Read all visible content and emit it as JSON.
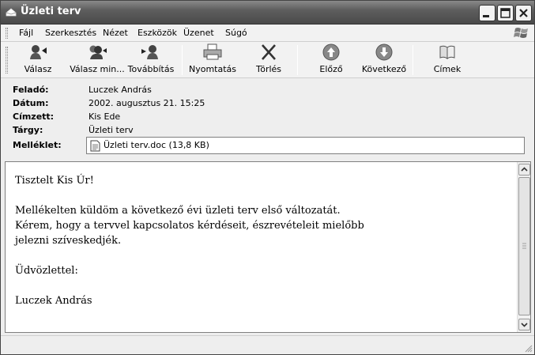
{
  "window": {
    "title": "Üzleti terv",
    "icon": "mail-envelope-icon",
    "controls": [
      "minimize-icon",
      "maximize-icon",
      "close-icon"
    ]
  },
  "menu": {
    "items": [
      "Fájl",
      "Szerkesztés",
      "Nézet",
      "Eszközök",
      "Üzenet",
      "Súgó"
    ]
  },
  "toolbar": {
    "buttons": [
      {
        "label": "Válasz",
        "icon": "reply-icon"
      },
      {
        "label": "Válasz min...",
        "icon": "reply-all-icon"
      },
      {
        "label": "Továbbítás",
        "icon": "forward-icon"
      },
      {
        "label": "Nyomtatás",
        "icon": "printer-icon"
      },
      {
        "label": "Törlés",
        "icon": "delete-x-icon"
      },
      {
        "label": "Előző",
        "icon": "previous-arrow-icon"
      },
      {
        "label": "Következő",
        "icon": "next-arrow-icon"
      },
      {
        "label": "Címek",
        "icon": "address-book-icon"
      }
    ]
  },
  "header": {
    "from_label": "Feladó:",
    "from_value": "Luczek András",
    "date_label": "Dátum:",
    "date_value": "2002. augusztus 21. 15:25",
    "to_label": "Címzett:",
    "to_value": "Kis Ede",
    "subject_label": "Tárgy:",
    "subject_value": "Üzleti terv",
    "attachment_label": "Melléklet:",
    "attachment_value": "Üzleti terv.doc (13,8 KB)"
  },
  "message": {
    "lines": [
      "Tisztelt Kis Úr!",
      "",
      "Mellékelten küldöm a következő évi üzleti terv első változatát.",
      "Kérem, hogy a tervvel kapcsolatos kérdéseit, észrevételeit mielőbb",
      "jelezni szíveskedjék.",
      "",
      "Üdvözlettel:",
      "",
      "Luczek András"
    ]
  }
}
